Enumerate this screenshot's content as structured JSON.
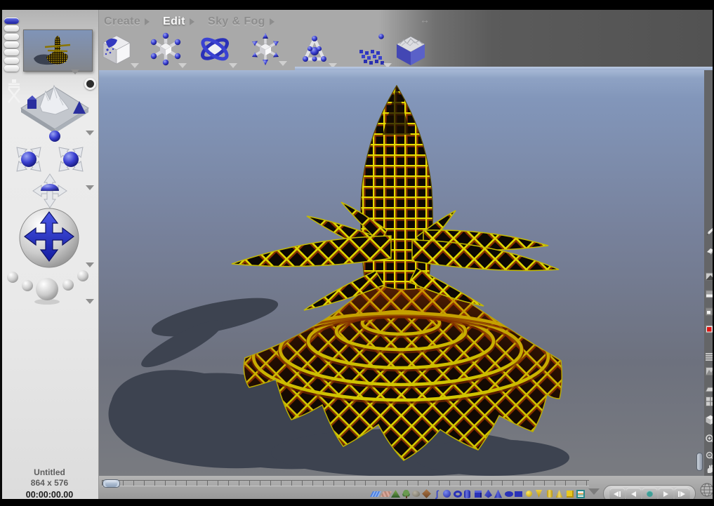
{
  "glyphs": {
    "pane_resize": "↔",
    "stream": "∫"
  },
  "menubar": {
    "items": [
      {
        "label": "Create"
      },
      {
        "label": "Edit"
      },
      {
        "label": "Sky & Fog"
      }
    ],
    "active_item": "Edit"
  },
  "toolbar": {
    "tools": [
      {
        "name": "texture-cube-tool",
        "dropdown": true
      },
      {
        "name": "resize-tool",
        "dropdown": true
      },
      {
        "name": "rotate-tool",
        "dropdown": true
      },
      {
        "name": "reposition-tool",
        "dropdown": true
      },
      {
        "name": "alignment-tool",
        "dropdown": true
      },
      {
        "name": "multi-replicate-tool",
        "dropdown": true
      },
      {
        "name": "terrain-editor-tool",
        "dropdown": false
      }
    ]
  },
  "sidebar": {
    "preset_pills": {
      "count": 7,
      "selected_index": 0
    },
    "controls": [
      "nano-preview",
      "director-chair",
      "camera-origin-dot",
      "scene-preview",
      "view-arrows",
      "pan-arrows",
      "camera-trackball",
      "camera-preset-spheres"
    ],
    "status": {
      "title": "Untitled",
      "resolution": "864 x 576",
      "timecode": "00:00:00.00"
    }
  },
  "viewport": {
    "content": "yellow wireframe-textured spire with radiating spikes and scalloped skirt casting shadow",
    "sky_top_color": "#8ea2c4",
    "horizon_color": "#6e7280",
    "grid_color": "#e2d800",
    "glow_color": "#8c2e00",
    "shadow_color": "#3d4350"
  },
  "create_palette": {
    "items": [
      "water-plane",
      "ground-plane",
      "terrain",
      "tree",
      "rock",
      "symmetrical-lattice",
      "stream",
      "sphere",
      "torus",
      "cylinder",
      "cube",
      "pyramid",
      "cone",
      "disc",
      "square",
      "radial-light",
      "spot-light",
      "round-parallel-light",
      "cone-light",
      "square-spot-light",
      "sky-lab"
    ]
  },
  "transport": {
    "buttons": [
      "go-to-start",
      "step-back",
      "record",
      "play",
      "go-to-end"
    ]
  },
  "right_rail": {
    "icons": [
      "pencil",
      "eraser",
      "wireframe-preview",
      "shaded-preview",
      "mixed-preview",
      "render",
      "document-lines",
      "terrain-clip",
      "plane-clip",
      "grid-view",
      "cube-view",
      "zoom-in",
      "zoom-out",
      "pan-hand",
      "globe"
    ]
  },
  "timeline": {
    "thumb_position": 0
  }
}
